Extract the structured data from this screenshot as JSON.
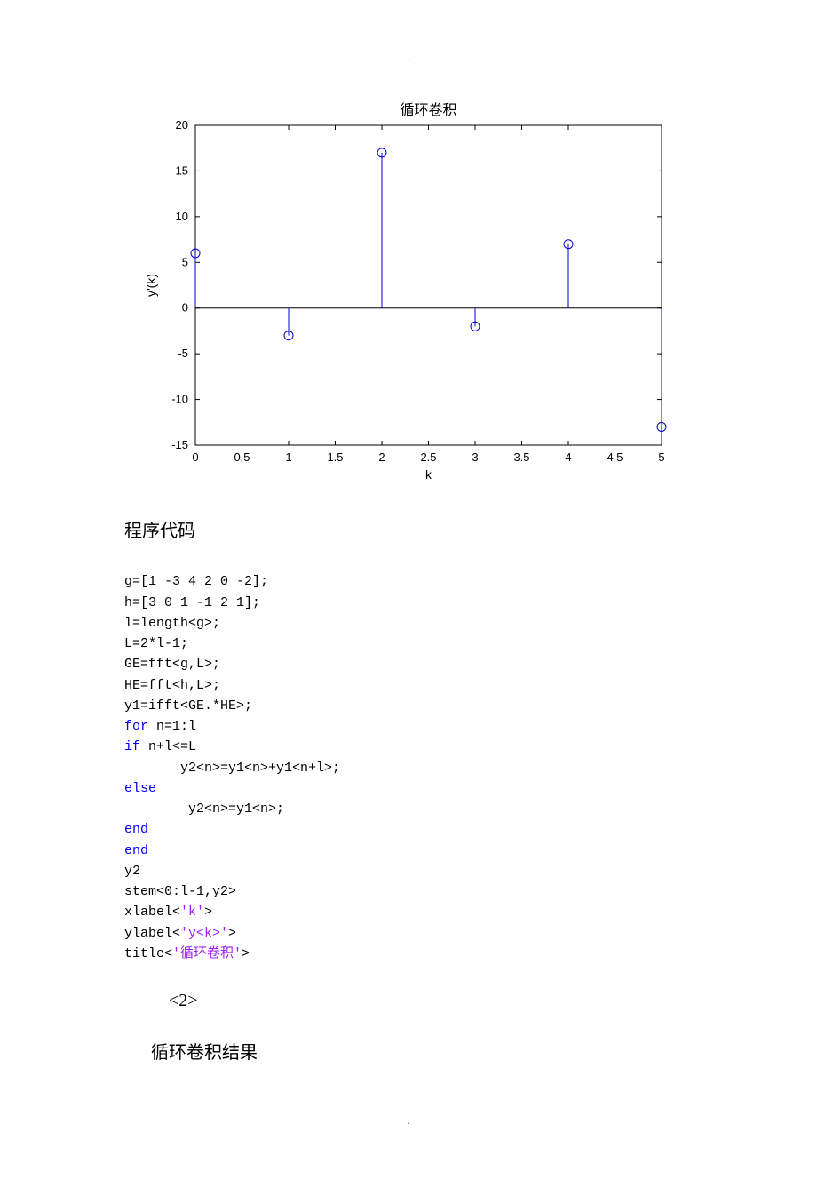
{
  "chart_data": {
    "type": "stem",
    "title": "循环卷积",
    "xlabel": "k",
    "ylabel": "y'(k)",
    "x": [
      0,
      1,
      2,
      3,
      4,
      5
    ],
    "y": [
      6,
      -3,
      17,
      -2,
      7,
      -13
    ],
    "xticks": [
      0,
      0.5,
      1,
      1.5,
      2,
      2.5,
      3,
      3.5,
      4,
      4.5,
      5
    ],
    "yticks": [
      -15,
      -10,
      -5,
      0,
      5,
      10,
      15,
      20
    ],
    "xlim": [
      0,
      5
    ],
    "ylim": [
      -15,
      20
    ]
  },
  "section": {
    "header": "程序代码",
    "sub1": "<2>",
    "sub2": "循环卷积结果"
  },
  "code": {
    "l1": "g=[1 -3 4 2 0 -2];",
    "l2": "h=[3 0 1 -1 2 1];",
    "l3": "l=length<g>;",
    "l4": "L=2*l-1;",
    "l5": "GE=fft<g,L>;",
    "l6": "HE=fft<h,L>;",
    "l7": "y1=ifft<GE.*HE>;",
    "l8a": "for",
    "l8b": " n=1:l",
    "l9a": "if",
    "l9b": " n+l<=L",
    "l10": "y2<n>=y1<n>+y1<n+l>;",
    "l11": "else",
    "l12": "y2<n>=y1<n>;",
    "l13": "end",
    "l14": "end",
    "l15": "y2",
    "l16": "stem<0:l-1,y2>",
    "l17a": "xlabel<",
    "l17b": "'k'",
    "l17c": ">",
    "l18a": "ylabel<",
    "l18b": "'y<k>'",
    "l18c": ">",
    "l19a": "title<",
    "l19b": "'循环卷积'",
    "l19c": ">"
  }
}
